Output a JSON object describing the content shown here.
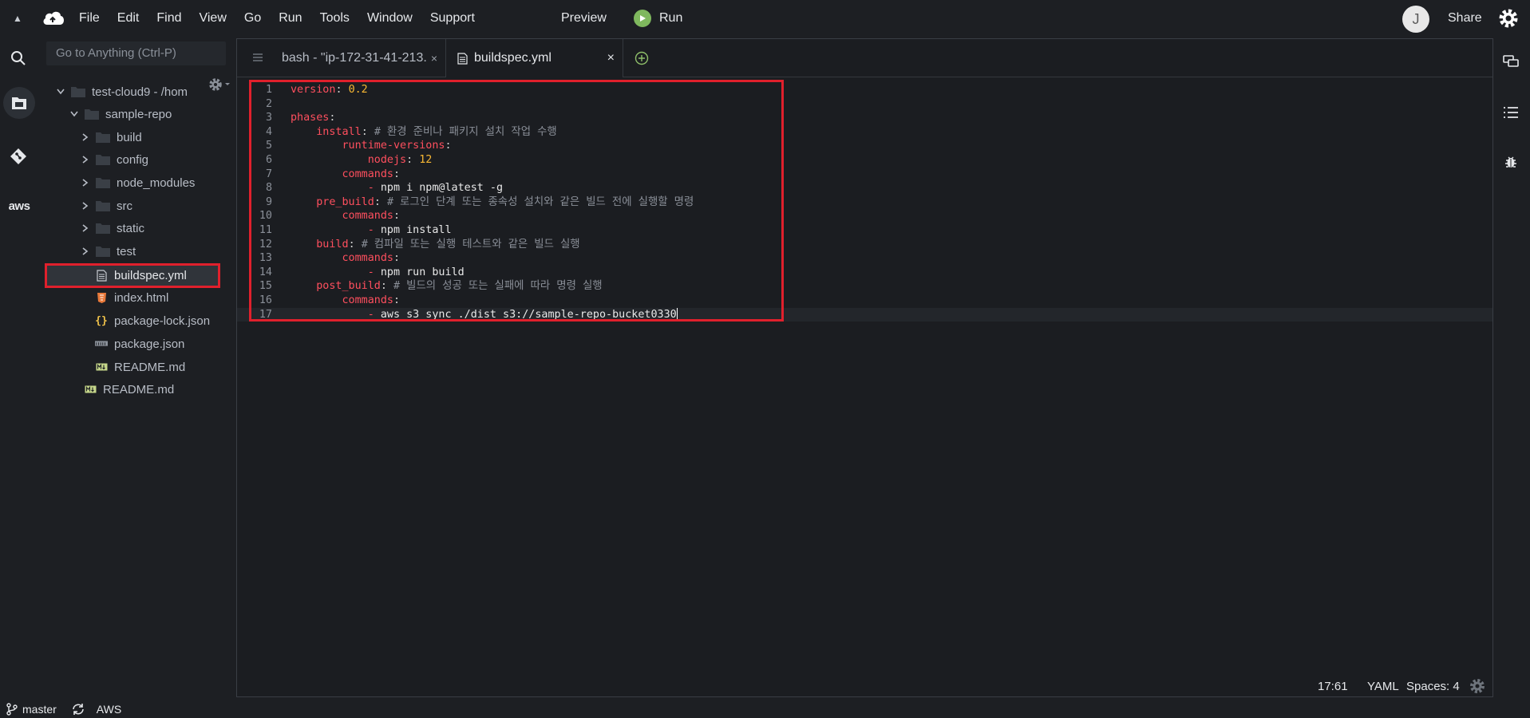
{
  "menubar": {
    "items": [
      "File",
      "Edit",
      "Find",
      "View",
      "Go",
      "Run",
      "Tools",
      "Window",
      "Support"
    ],
    "preview": "Preview",
    "run": "Run",
    "avatar_letter": "J",
    "share": "Share"
  },
  "sidebar": {
    "aws_label": "aws",
    "goto_placeholder": "Go to Anything (Ctrl-P)"
  },
  "tree": {
    "root": "test-cloud9 - /hom",
    "repo": "sample-repo",
    "folders": [
      "build",
      "config",
      "node_modules",
      "src",
      "static",
      "test"
    ],
    "files": [
      "buildspec.yml",
      "index.html",
      "package-lock.json",
      "package.json",
      "README.md"
    ],
    "root_file": "README.md"
  },
  "tabs": {
    "tab1": "bash - \"ip-172-31-41-213.",
    "tab2": "buildspec.yml",
    "close": "×"
  },
  "code": {
    "line_numbers": [
      "1",
      "2",
      "3",
      "4",
      "5",
      "6",
      "7",
      "8",
      "9",
      "10",
      "11",
      "12",
      "13",
      "14",
      "15",
      "16",
      "17"
    ],
    "l1_key": "version",
    "l1_val": "0.2",
    "l3_key": "phases",
    "l4_key": "install",
    "l4_comment": "# 환경 준비나 패키지 설치 작업 수행",
    "l5_key": "runtime-versions",
    "l6_key": "nodejs",
    "l6_val": "12",
    "l7_key": "commands",
    "l8_val": "npm i npm@latest -g",
    "l9_key": "pre_build",
    "l9_comment": "# 로그인 단계 또는 종속성 설치와 같은 빌드 전에 실행할 명령",
    "l10_key": "commands",
    "l11_val": "npm install",
    "l12_key": "build",
    "l12_comment": "# 컴파일 또는 실행 테스트와 같은 빌드 실행",
    "l13_key": "commands",
    "l14_val": "npm run build",
    "l15_key": "post_build",
    "l15_comment": "# 빌드의 성공 또는 실패에 따라 명령 실행",
    "l16_key": "commands",
    "l17_val": "aws s3 sync ./dist s3://sample-repo-bucket0330"
  },
  "status": {
    "position": "17:61",
    "language": "YAML",
    "spaces": "Spaces: 4"
  },
  "bottom": {
    "branch": "master",
    "aws": "AWS"
  },
  "colors": {
    "highlight_box": "#e0202c",
    "keyword": "#ff4f5e",
    "number": "#f7b733",
    "run_green": "#7fb85e"
  }
}
